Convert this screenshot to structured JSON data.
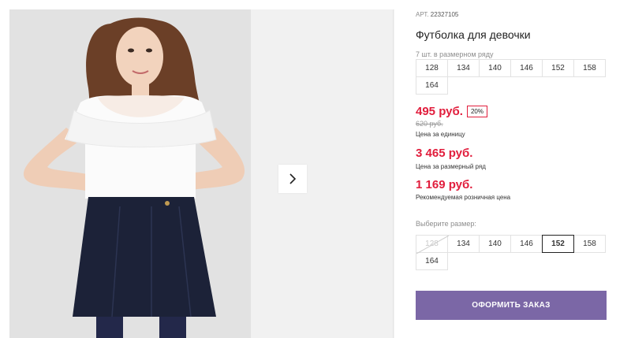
{
  "gallery": {
    "photo_alt": "",
    "next_icon": "chevron-right-icon"
  },
  "product": {
    "sku_label": "АРТ.",
    "sku_value": "22327105",
    "title": "Футболка для девочки",
    "range_note": "7 шт. в размерном ряду",
    "range_sizes": [
      "128",
      "134",
      "140",
      "146",
      "152",
      "158",
      "164"
    ],
    "price_unit": "495 руб.",
    "discount_badge": "20%",
    "old_price": "620 руб.",
    "price_unit_caption": "Цена за единицу",
    "price_range": "3 465 руб.",
    "price_range_caption": "Цена за размерный ряд",
    "price_retail": "1 169 руб.",
    "price_retail_caption": "Рекомендуемая розничная цена",
    "choose_size_label": "Выберите размер:",
    "choose_sizes": [
      {
        "label": "128",
        "state": "disabled"
      },
      {
        "label": "134",
        "state": "normal"
      },
      {
        "label": "140",
        "state": "normal"
      },
      {
        "label": "146",
        "state": "normal"
      },
      {
        "label": "152",
        "state": "selected"
      },
      {
        "label": "158",
        "state": "normal"
      },
      {
        "label": "164",
        "state": "normal"
      }
    ],
    "order_button": "ОФОРМИТЬ ЗАКАЗ"
  },
  "colors": {
    "price_red": "#e11d3c",
    "order_button_bg": "#7b67a6"
  }
}
